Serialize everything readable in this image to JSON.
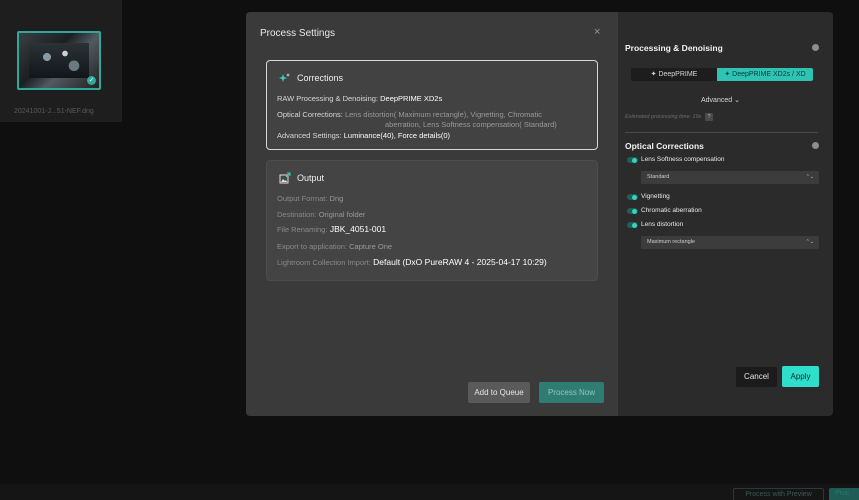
{
  "background": {
    "thumbnail_name": "20241001-J...51-NEF.dng",
    "check_glyph": "✓",
    "process_with_preview_label": "Process with Preview",
    "other_button_label": "Proc"
  },
  "dialog": {
    "title": "Process Settings",
    "close_glyph": "×",
    "corrections": {
      "heading": "Corrections",
      "icon": "sparkle-icon",
      "raw_label": "RAW Processing & Denoising:",
      "raw_value": "DeepPRIME XD2s",
      "optical_label": "Optical Corrections:",
      "optical_value_line1": "Lens distortion( Maximum rectangle), Vignetting, Chromatic",
      "optical_value_line2": "aberration, Lens Softness compensation( Standard)",
      "advanced_label": "Advanced Settings:",
      "advanced_value": "Luminance(40), Force details(0)"
    },
    "output": {
      "heading": "Output",
      "icon": "image-export-icon",
      "format_label": "Output Format:",
      "format_value": "Dng",
      "destination_label": "Destination:",
      "destination_value": "Original folder",
      "renaming_label": "File Renaming:",
      "renaming_value": "JBK_4051-001",
      "export_label": "Export to application:",
      "export_value": "Capture One",
      "lightroom_label": "Lightroom Collection Import:",
      "lightroom_value": "Default (DxO PureRAW 4 - 2025-04-17 10:29)"
    },
    "add_to_queue_label": "Add to Queue",
    "process_now_label": "Process Now"
  },
  "panel": {
    "processing_title": "Processing & Denoising",
    "mode_a_label": "✦ DeepPRIME",
    "mode_b_label": "✦ DeepPRIME XD2s / XD",
    "advanced_label": "Advanced  ⌄",
    "estimate_label": "Estimated processing time: 19s",
    "estimate_help": "?",
    "optical_title": "Optical Corrections",
    "lens_softness_label": "Lens Softness compensation",
    "lens_softness_select": "Standard",
    "vignetting_label": "Vignetting",
    "chromatic_label": "Chromatic aberration",
    "lens_distortion_label": "Lens distortion",
    "lens_distortion_select": "Maximum rectangle",
    "select_chevron": "⌃⌄",
    "cancel_label": "Cancel",
    "apply_label": "Apply"
  },
  "colors": {
    "accent": "#2ee0cc",
    "process_now": "#2f7d72",
    "dialog_bg": "#3a3a3a",
    "panel_bg": "#2b2b2b"
  }
}
